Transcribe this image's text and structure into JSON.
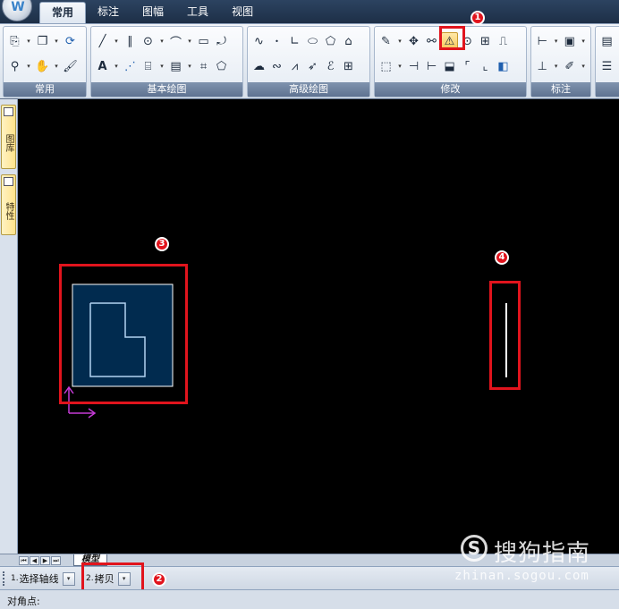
{
  "ribbon": {
    "tabs": [
      {
        "label": "常用",
        "active": true
      },
      {
        "label": "标注",
        "active": false
      },
      {
        "label": "图幅",
        "active": false
      },
      {
        "label": "工具",
        "active": false
      },
      {
        "label": "视图",
        "active": false
      }
    ],
    "panels": [
      {
        "title": "常用"
      },
      {
        "title": "基本绘图"
      },
      {
        "title": "高级绘图"
      },
      {
        "title": "修改"
      },
      {
        "title": "标注"
      }
    ]
  },
  "markers": [
    "1",
    "2",
    "3",
    "4"
  ],
  "left_palette": {
    "tabs": [
      {
        "label": "图库"
      },
      {
        "label": "特性"
      }
    ]
  },
  "layout_tabs": {
    "model_label": "模型"
  },
  "command_bar": {
    "items": [
      {
        "num": "1.",
        "label": "选择轴线"
      },
      {
        "num": "2.",
        "label": "拷贝"
      }
    ]
  },
  "status_bar": {
    "prompt": "对角点:"
  },
  "watermark": {
    "logo_letter": "S",
    "text": "搜狗指南",
    "url": "zhinan.sogou.com"
  },
  "colors": {
    "canvas_bg": "#000000",
    "highlight_red": "#e1141d",
    "selection_fill": "#012b4f",
    "selection_stroke": "#ffffff",
    "entity_stroke": "#b3d3f2",
    "ucs_color": "#c53bd6"
  },
  "icons": {
    "mirror_tool": "mirror-icon"
  }
}
